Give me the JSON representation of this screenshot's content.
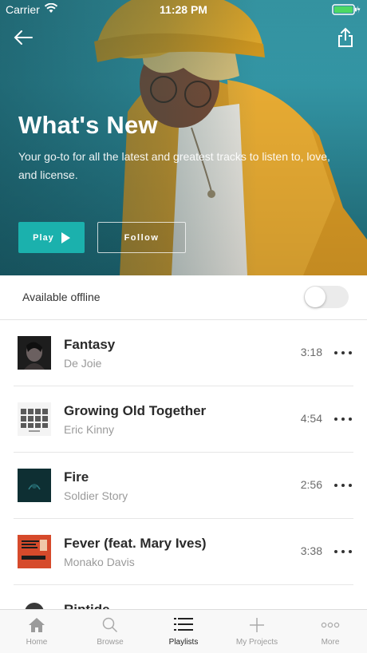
{
  "status_bar": {
    "carrier": "Carrier",
    "time": "11:28 PM"
  },
  "hero": {
    "title": "What's New",
    "description": "Your go-to for all the latest and greatest tracks to listen to, love, and license.",
    "play_label": "Play",
    "follow_label": "Follow",
    "icons": {
      "back": "back-arrow-icon",
      "share": "share-icon",
      "play": "play-icon"
    }
  },
  "offline": {
    "label": "Available offline",
    "enabled": false
  },
  "tracks": [
    {
      "title": "Fantasy",
      "artist": "De Joie",
      "duration": "3:18"
    },
    {
      "title": "Growing Old Together",
      "artist": "Eric Kinny",
      "duration": "4:54"
    },
    {
      "title": "Fire",
      "artist": "Soldier Story",
      "duration": "2:56"
    },
    {
      "title": "Fever (feat. Mary Ives)",
      "artist": "Monako Davis",
      "duration": "3:38"
    },
    {
      "title": "Riptide",
      "artist": "",
      "duration": ""
    }
  ],
  "tabbar": {
    "items": [
      {
        "label": "Home",
        "icon": "home-icon"
      },
      {
        "label": "Browse",
        "icon": "search-icon"
      },
      {
        "label": "Playlists",
        "icon": "playlists-icon",
        "active": true
      },
      {
        "label": "My Projects",
        "icon": "plus-icon"
      },
      {
        "label": "More",
        "icon": "more-icon"
      }
    ]
  },
  "colors": {
    "accent": "#1bb1ad",
    "hero_bg": "#2f8d9c",
    "jacket": "#e2a22a"
  }
}
